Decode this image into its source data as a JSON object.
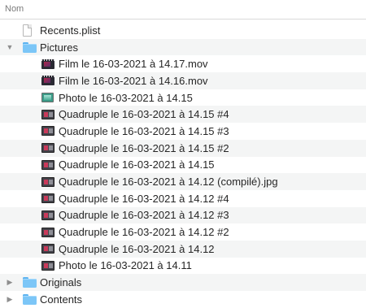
{
  "header": {
    "column_name": "Nom"
  },
  "items": [
    {
      "label": "Recents.plist",
      "kind": "plist",
      "indent": 0,
      "disclosure": ""
    },
    {
      "label": "Pictures",
      "kind": "folder",
      "indent": 0,
      "disclosure": "▼"
    },
    {
      "label": "Film le 16-03-2021 à 14.17.mov",
      "kind": "movie",
      "indent": 1,
      "disclosure": ""
    },
    {
      "label": "Film le 16-03-2021 à 14.16.mov",
      "kind": "movie",
      "indent": 1,
      "disclosure": ""
    },
    {
      "label": "Photo le 16-03-2021 à 14.15",
      "kind": "photo",
      "indent": 1,
      "disclosure": ""
    },
    {
      "label": "Quadruple le 16-03-2021 à 14.15 #4",
      "kind": "quad",
      "indent": 1,
      "disclosure": ""
    },
    {
      "label": "Quadruple le 16-03-2021 à 14.15 #3",
      "kind": "quad",
      "indent": 1,
      "disclosure": ""
    },
    {
      "label": "Quadruple le 16-03-2021 à 14.15 #2",
      "kind": "quad",
      "indent": 1,
      "disclosure": ""
    },
    {
      "label": "Quadruple le 16-03-2021 à 14.15",
      "kind": "quad",
      "indent": 1,
      "disclosure": ""
    },
    {
      "label": "Quadruple le 16-03-2021 à 14.12 (compilé).jpg",
      "kind": "quad",
      "indent": 1,
      "disclosure": ""
    },
    {
      "label": "Quadruple le 16-03-2021 à 14.12 #4",
      "kind": "quad",
      "indent": 1,
      "disclosure": ""
    },
    {
      "label": "Quadruple le 16-03-2021 à 14.12 #3",
      "kind": "quad",
      "indent": 1,
      "disclosure": ""
    },
    {
      "label": "Quadruple le 16-03-2021 à 14.12 #2",
      "kind": "quad",
      "indent": 1,
      "disclosure": ""
    },
    {
      "label": "Quadruple le 16-03-2021 à 14.12",
      "kind": "quad",
      "indent": 1,
      "disclosure": ""
    },
    {
      "label": "Photo le 16-03-2021 à 14.11",
      "kind": "quad",
      "indent": 1,
      "disclosure": ""
    },
    {
      "label": "Originals",
      "kind": "folder",
      "indent": 0,
      "disclosure": "▶"
    },
    {
      "label": "Contents",
      "kind": "folder",
      "indent": 0,
      "disclosure": "▶"
    }
  ]
}
